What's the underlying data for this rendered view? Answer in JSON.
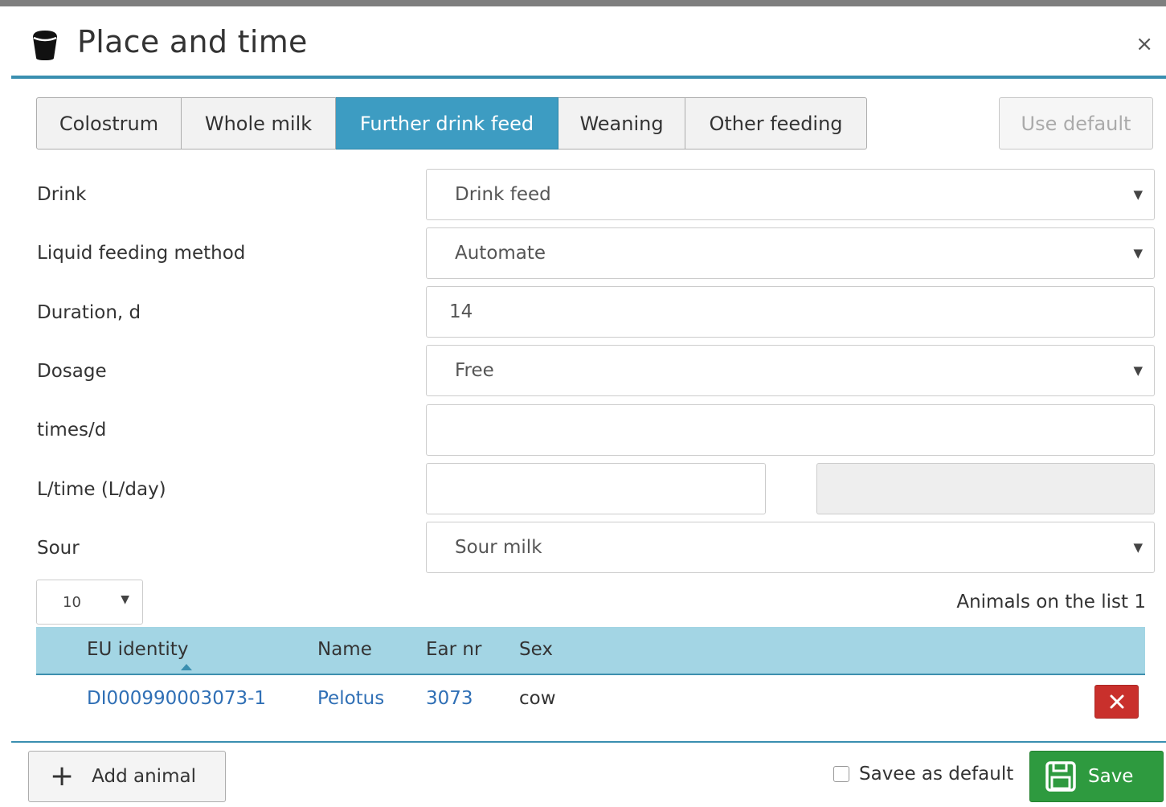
{
  "dialog": {
    "title": "Place and time",
    "close_label": "×",
    "icon": "bucket-icon"
  },
  "tabs": [
    {
      "label": "Colostrum",
      "active": false
    },
    {
      "label": "Whole milk",
      "active": false
    },
    {
      "label": "Further drink feed",
      "active": true
    },
    {
      "label": "Weaning",
      "active": false
    },
    {
      "label": "Other feeding",
      "active": false
    }
  ],
  "use_default_label": "Use default",
  "form": {
    "drink": {
      "label": "Drink",
      "value": "Drink feed"
    },
    "liquid_method": {
      "label": "Liquid feeding method",
      "value": "Automate"
    },
    "duration": {
      "label": "Duration, d",
      "value": "14"
    },
    "dosage": {
      "label": "Dosage",
      "value": "Free"
    },
    "times_per_day": {
      "label": "times/d",
      "value": ""
    },
    "liters": {
      "label": "L/time (L/day)",
      "value": "",
      "per_day_value": ""
    },
    "sour": {
      "label": "Sour",
      "value": "Sour milk"
    }
  },
  "list": {
    "page_length": "10",
    "animals_count_text": "Animals on the list 1",
    "columns": [
      "EU identity",
      "Name",
      "Ear nr",
      "Sex"
    ],
    "rows": [
      {
        "eu_identity": "DI000990003073-1",
        "name": "Pelotus",
        "ear_nr": "3073",
        "sex": "cow"
      }
    ]
  },
  "footer": {
    "add_animal_label": "Add animal",
    "save_default_label": "Savee as default",
    "save_label": "Save"
  },
  "colors": {
    "accent": "#3d9cc2",
    "table_header": "#a3d5e4",
    "save": "#2e9a3f",
    "delete": "#c9302c",
    "link": "#2f6fb5"
  }
}
